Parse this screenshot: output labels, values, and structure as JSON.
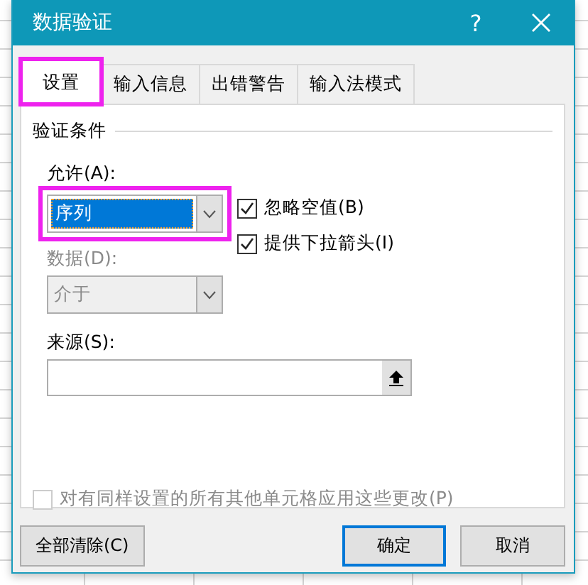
{
  "dialog": {
    "title": "数据验证",
    "help": "?"
  },
  "tabs": [
    {
      "label": "设置",
      "selected": true,
      "highlighted": true
    },
    {
      "label": "输入信息",
      "selected": false,
      "highlighted": false
    },
    {
      "label": "出错警告",
      "selected": false,
      "highlighted": false
    },
    {
      "label": "输入法模式",
      "selected": false,
      "highlighted": false
    }
  ],
  "section": "验证条件",
  "allow": {
    "label": "允许(A):",
    "value": "序列",
    "highlighted": true,
    "disabled": false
  },
  "options": [
    {
      "label": "忽略空值(B)",
      "checked": true,
      "disabled": false
    },
    {
      "label": "提供下拉箭头(I)",
      "checked": true,
      "disabled": false
    }
  ],
  "data": {
    "label": "数据(D):",
    "value": "介于",
    "disabled": true
  },
  "source": {
    "label": "来源(S):"
  },
  "apply_all": {
    "label": "对有同样设置的所有其他单元格应用这些更改(P)",
    "checked": false,
    "disabled": true
  },
  "buttons": [
    {
      "label": "全部清除(C)",
      "default": false
    },
    {
      "label": "确定",
      "default": true
    },
    {
      "label": "取消",
      "default": false
    }
  ]
}
